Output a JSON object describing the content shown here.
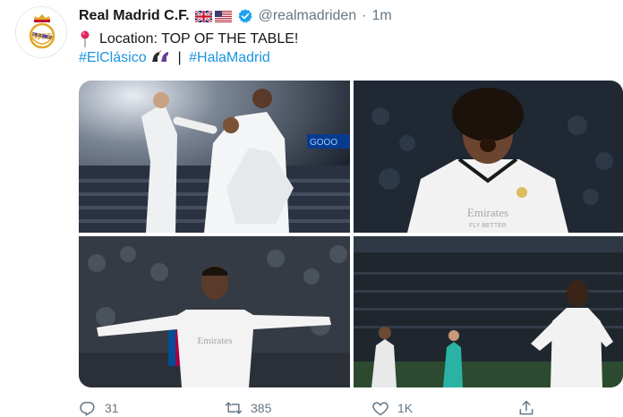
{
  "tweet": {
    "author_name": "Real Madrid C.F.",
    "handle": "@realmadriden",
    "separator": "·",
    "time": "1m",
    "location_text": "Location: TOP OF THE TABLE!",
    "hashtag_1": "#ElClásico",
    "divider": "|",
    "hashtag_2": "#HalaMadrid",
    "flags": [
      "uk-flag",
      "us-flag"
    ]
  },
  "media": {
    "photos": [
      {
        "icon": "celebration-group-photo"
      },
      {
        "icon": "marcelo-shout-photo"
      },
      {
        "icon": "mariano-arms-wide-photo"
      },
      {
        "icon": "vinicius-celebration-photo"
      }
    ],
    "shirt_sponsor": "Emirates",
    "shirt_tagline": "FLY BETTER"
  },
  "actions": {
    "replies": "31",
    "retweets": "385",
    "likes": "1K"
  },
  "colors": {
    "link": "#1b95e0",
    "muted": "#657786",
    "verified": "#1da1f2"
  }
}
